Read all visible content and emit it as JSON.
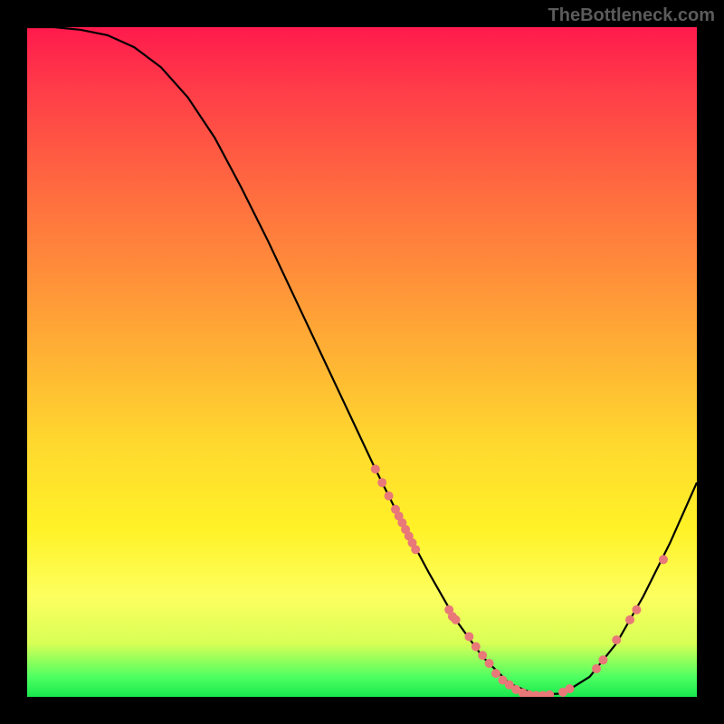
{
  "watermark": "TheBottleneck.com",
  "chart_data": {
    "type": "line",
    "title": "",
    "xlabel": "",
    "ylabel": "",
    "xlim": [
      0,
      100
    ],
    "ylim": [
      0,
      100
    ],
    "curve": {
      "x": [
        0,
        4,
        8,
        12,
        16,
        20,
        24,
        28,
        32,
        36,
        40,
        44,
        48,
        52,
        56,
        60,
        64,
        68,
        72,
        76,
        80,
        84,
        88,
        92,
        96,
        100
      ],
      "y": [
        100,
        100,
        99.6,
        98.8,
        97,
        94,
        89.5,
        83.5,
        76,
        68,
        59.5,
        51,
        42.5,
        34,
        26,
        18.5,
        11.5,
        6,
        2,
        0.3,
        0.5,
        3,
        8,
        15,
        23,
        32
      ]
    },
    "points": [
      {
        "x": 52,
        "y": 34
      },
      {
        "x": 53,
        "y": 32
      },
      {
        "x": 54,
        "y": 30
      },
      {
        "x": 55,
        "y": 28
      },
      {
        "x": 55.5,
        "y": 27
      },
      {
        "x": 56,
        "y": 26
      },
      {
        "x": 56.5,
        "y": 25
      },
      {
        "x": 57,
        "y": 24
      },
      {
        "x": 57.5,
        "y": 23
      },
      {
        "x": 58,
        "y": 22
      },
      {
        "x": 63,
        "y": 13
      },
      {
        "x": 63.5,
        "y": 12
      },
      {
        "x": 64,
        "y": 11.5
      },
      {
        "x": 66,
        "y": 9
      },
      {
        "x": 67,
        "y": 7.5
      },
      {
        "x": 68,
        "y": 6.2
      },
      {
        "x": 69,
        "y": 5
      },
      {
        "x": 70,
        "y": 3.5
      },
      {
        "x": 71,
        "y": 2.5
      },
      {
        "x": 72,
        "y": 1.8
      },
      {
        "x": 73,
        "y": 1.1
      },
      {
        "x": 74,
        "y": 0.6
      },
      {
        "x": 75,
        "y": 0.3
      },
      {
        "x": 76,
        "y": 0.2
      },
      {
        "x": 77,
        "y": 0.2
      },
      {
        "x": 78,
        "y": 0.3
      },
      {
        "x": 80,
        "y": 0.7
      },
      {
        "x": 81,
        "y": 1.2
      },
      {
        "x": 85,
        "y": 4.2
      },
      {
        "x": 86,
        "y": 5.5
      },
      {
        "x": 88,
        "y": 8.5
      },
      {
        "x": 90,
        "y": 11.5
      },
      {
        "x": 91,
        "y": 13
      },
      {
        "x": 95,
        "y": 20.5
      }
    ]
  }
}
